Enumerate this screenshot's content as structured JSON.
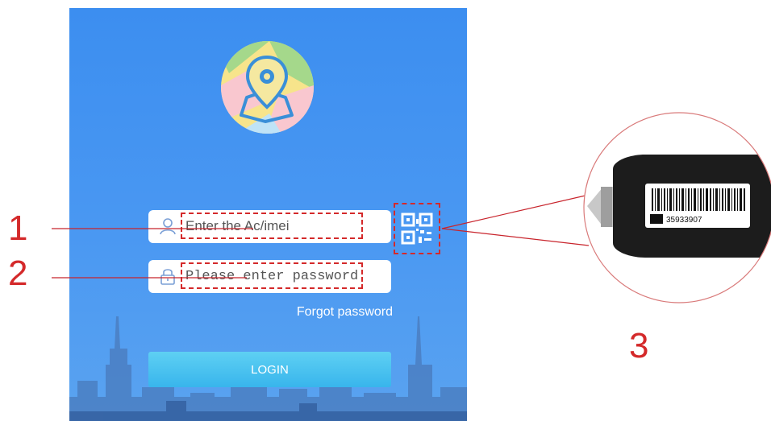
{
  "login": {
    "username_placeholder": "Enter the Ac/imei",
    "password_placeholder": "Please enter password",
    "forgot_label": "Forgot password",
    "login_label": "LOGIN"
  },
  "annotations": {
    "label_1": "1",
    "label_2": "2",
    "label_3": "3"
  },
  "device_photo": {
    "barcode_text": "35933907"
  },
  "icons": {
    "logo": "map-pin-logo-icon",
    "user": "user-icon",
    "password": "lock-icon",
    "qr": "qr-scan-icon"
  },
  "colors": {
    "background_blue": "#3c8ef0",
    "login_button": "#45c0ef",
    "annotation_red": "#d4292a"
  }
}
